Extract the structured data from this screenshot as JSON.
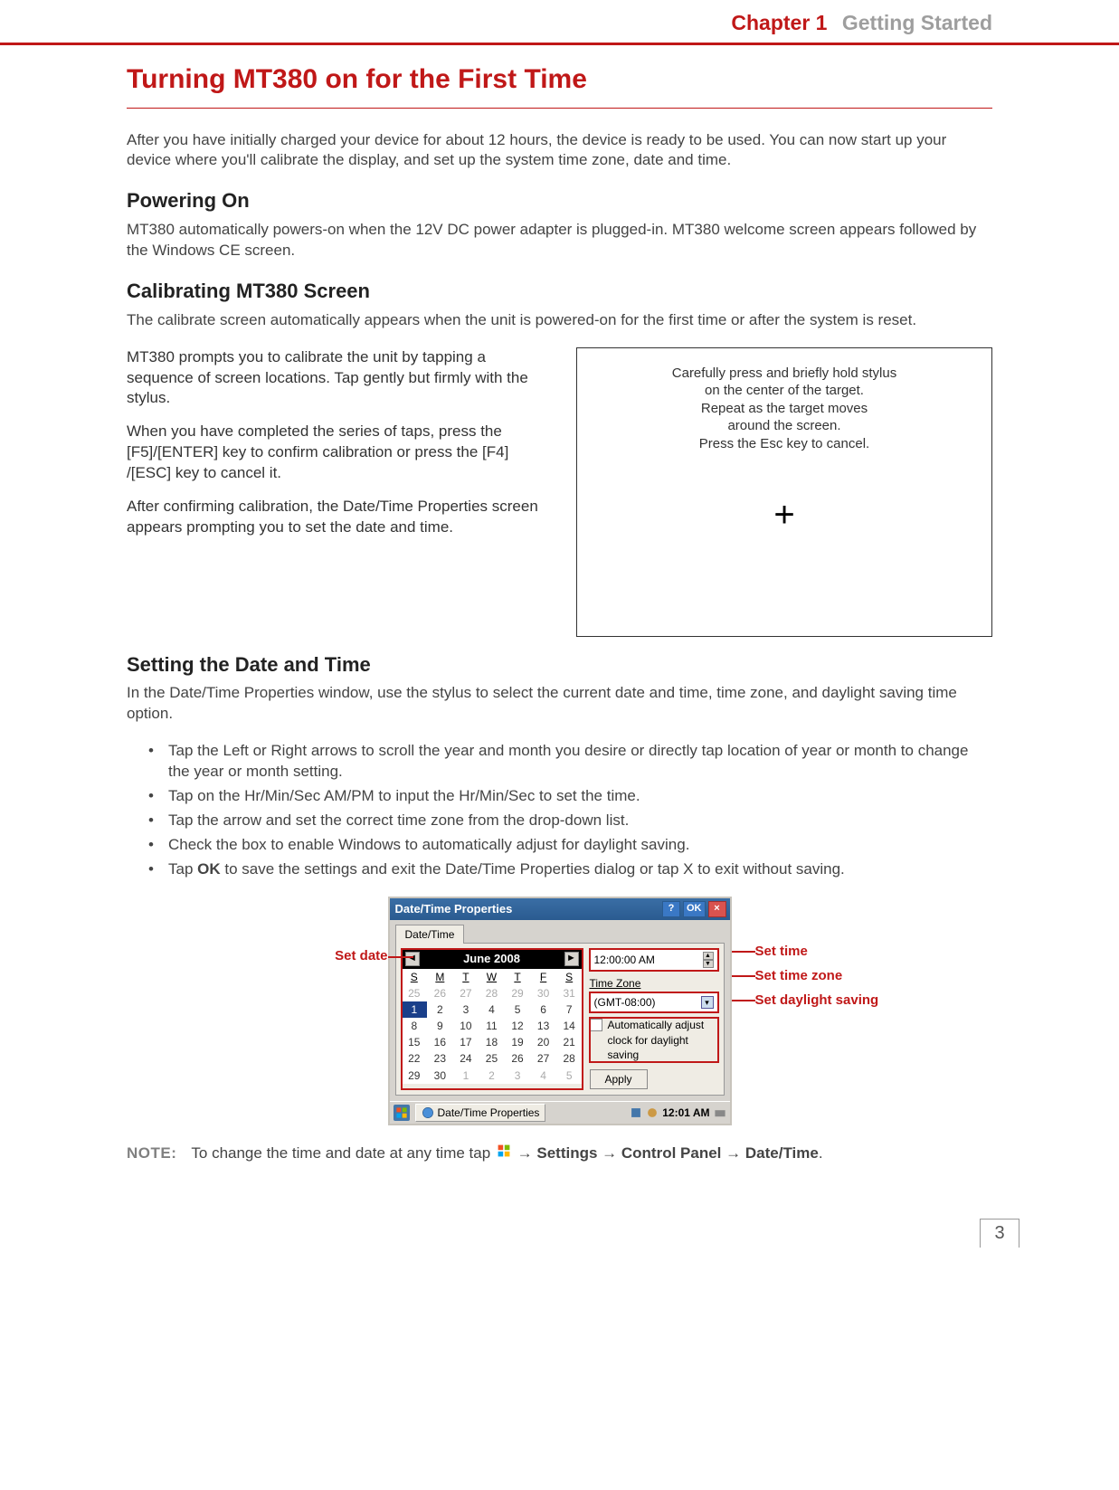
{
  "header": {
    "chapter": "Chapter 1",
    "title": "Getting Started"
  },
  "main_title": "Turning MT380 on for the First Time",
  "intro": "After you have initially charged your device for about 12 hours, the device is ready to be used. You can now start up your device where you'll calibrate the display, and set up the system time zone, date and time.",
  "powering": {
    "heading": "Powering On",
    "text": "MT380 automatically powers-on when the 12V DC power adapter is plugged-in. MT380 welcome screen appears followed by the Windows CE screen."
  },
  "calibrating": {
    "heading": "Calibrating MT380 Screen",
    "intro": "The calibrate screen automatically appears when the unit is powered-on for the first time or after the system is reset.",
    "p1": "MT380 prompts you to calibrate the unit by tapping a sequence of screen locations. Tap gently but firmly with the stylus.",
    "p2": "When you have completed the series of taps, press the [F5]/[ENTER] key to confirm calibration or press the [F4] /[ESC] key to cancel it.",
    "p3": "After confirming calibration, the Date/Time Properties screen appears prompting you to set the date and time.",
    "box_l1": "Carefully press and briefly hold stylus",
    "box_l2": "on the center of the target.",
    "box_l3": "Repeat as the target moves",
    "box_l4": "around the screen.",
    "box_l5": "Press the Esc key to cancel."
  },
  "datetime": {
    "heading": "Setting the Date and Time",
    "intro": "In the Date/Time Properties window, use the stylus to select the current date and time, time zone, and daylight saving time option.",
    "b1": "Tap the Left or Right arrows to scroll the year and month you desire or directly tap location of year or month to change the year or month setting.",
    "b2": "Tap on the Hr/Min/Sec AM/PM to input the Hr/Min/Sec to set the time.",
    "b3": "Tap the arrow and set the correct time zone from the drop-down list.",
    "b4": "Check the box to enable Windows to automatically adjust for daylight saving.",
    "b5_pre": "Tap ",
    "b5_bold": "OK",
    "b5_post": " to save the settings and exit the Date/Time Properties dialog or tap X to exit without saving."
  },
  "callouts": {
    "set_date": "Set date",
    "set_time": "Set time",
    "set_tz": "Set time zone",
    "set_dst": "Set daylight saving"
  },
  "window": {
    "title": "Date/Time Properties",
    "help": "?",
    "ok": "OK",
    "close": "×",
    "tab": "Date/Time",
    "month": "June 2008",
    "dow": [
      "S",
      "M",
      "T",
      "W",
      "T",
      "F",
      "S"
    ],
    "rows": [
      [
        {
          "v": "25",
          "dim": true
        },
        {
          "v": "26",
          "dim": true
        },
        {
          "v": "27",
          "dim": true
        },
        {
          "v": "28",
          "dim": true
        },
        {
          "v": "29",
          "dim": true
        },
        {
          "v": "30",
          "dim": true
        },
        {
          "v": "31",
          "dim": true
        }
      ],
      [
        {
          "v": "1",
          "sel": true
        },
        {
          "v": "2"
        },
        {
          "v": "3"
        },
        {
          "v": "4"
        },
        {
          "v": "5"
        },
        {
          "v": "6"
        },
        {
          "v": "7"
        }
      ],
      [
        {
          "v": "8"
        },
        {
          "v": "9"
        },
        {
          "v": "10"
        },
        {
          "v": "11"
        },
        {
          "v": "12"
        },
        {
          "v": "13"
        },
        {
          "v": "14"
        }
      ],
      [
        {
          "v": "15"
        },
        {
          "v": "16"
        },
        {
          "v": "17"
        },
        {
          "v": "18"
        },
        {
          "v": "19"
        },
        {
          "v": "20"
        },
        {
          "v": "21"
        }
      ],
      [
        {
          "v": "22"
        },
        {
          "v": "23"
        },
        {
          "v": "24"
        },
        {
          "v": "25"
        },
        {
          "v": "26"
        },
        {
          "v": "27"
        },
        {
          "v": "28"
        }
      ],
      [
        {
          "v": "29"
        },
        {
          "v": "30"
        },
        {
          "v": "1",
          "dim": true
        },
        {
          "v": "2",
          "dim": true
        },
        {
          "v": "3",
          "dim": true
        },
        {
          "v": "4",
          "dim": true
        },
        {
          "v": "5",
          "dim": true
        }
      ]
    ],
    "time_value": "12:00:00 AM",
    "tz_label": "Time Zone",
    "tz_value": "(GMT-08:00)",
    "dst_text": "Automatically adjust clock for daylight saving",
    "apply": "Apply",
    "taskbar_label": "Date/Time Properties",
    "clock": "12:01 AM"
  },
  "note": {
    "label": "NOTE:",
    "pre": "To change the time and date at any time tap ",
    "path1": " → ",
    "settings": "Settings",
    "path2": " → ",
    "cp": "Control Panel",
    "path3": " → ",
    "dt": "Date/Time",
    "dot": "."
  },
  "page_number": "3"
}
